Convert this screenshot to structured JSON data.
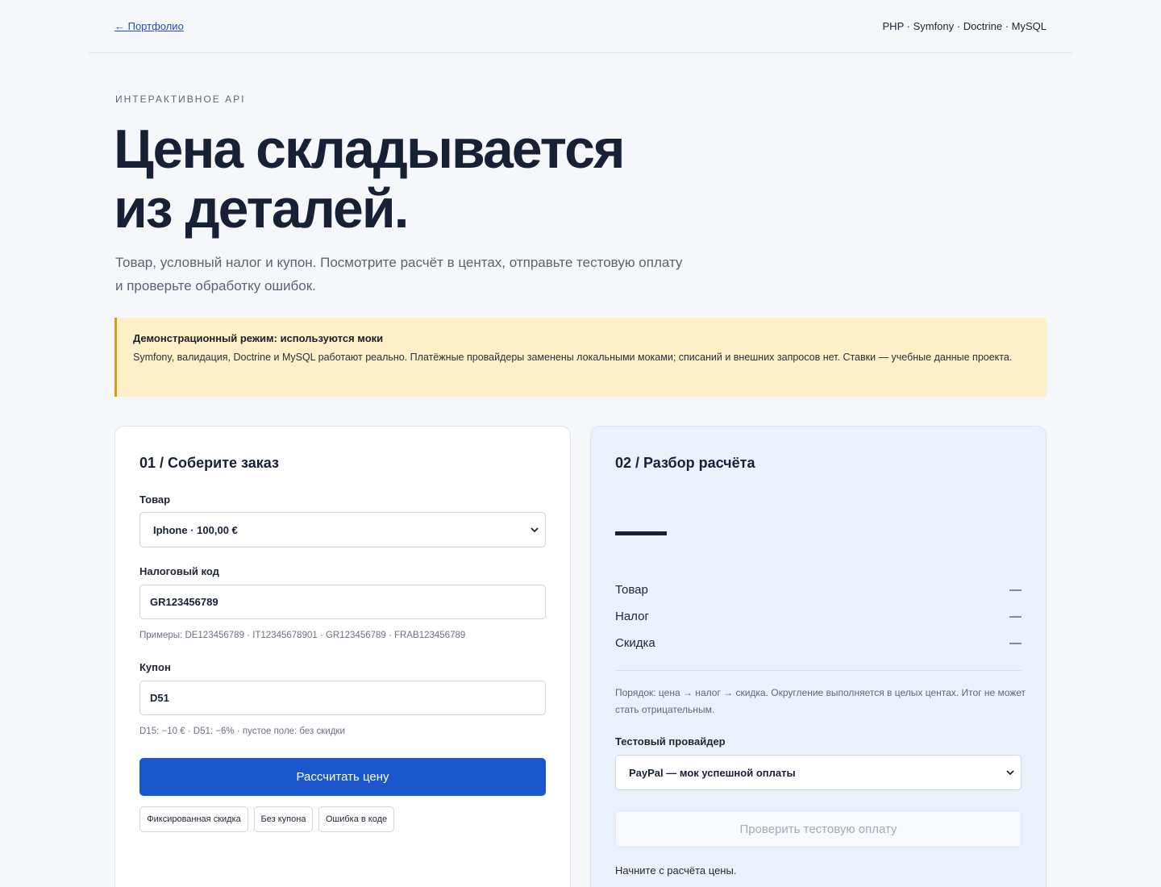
{
  "topbar": {
    "back_link": "← Портфолио",
    "stack": "PHP · Symfony · Doctrine · MySQL"
  },
  "hero": {
    "eyebrow": "ИНТЕРАКТИВНОЕ API",
    "title_line1": "Цена складывается",
    "title_line2": "из деталей.",
    "subtitle_line1": "Товар, условный налог и купон. Посмотрите расчёт в центах, отправьте тестовую оплату",
    "subtitle_line2": "и проверьте обработку ошибок."
  },
  "notice": {
    "title": "Демонстрационный режим: используются моки",
    "text": "Symfony, валидация, Doctrine и MySQL работают реально. Платёжные провайдеры заменены локальными моками; списаний и внешних запросов нет. Ставки — учебные данные проекта."
  },
  "order_card": {
    "title": "01 / Соберите заказ",
    "product_label": "Товар",
    "product_value": "Iphone · 100,00 €",
    "tax_label": "Налоговый код",
    "tax_value": "GR123456789",
    "tax_hint": "Примеры: DE123456789 · IT12345678901 · GR123456789 · FRAB123456789",
    "coupon_label": "Купон",
    "coupon_value": "D51",
    "coupon_hint": "D15: −10 € · D51: −6% · пустое поле: без скидки",
    "calculate_button": "Рассчитать цену",
    "presets": [
      "Фиксированная скидка",
      "Без купона",
      "Ошибка в коде"
    ]
  },
  "breakdown_card": {
    "title": "02 / Разбор расчёта",
    "rows": [
      {
        "label": "Товар",
        "value": "—"
      },
      {
        "label": "Налог",
        "value": "—"
      },
      {
        "label": "Скидка",
        "value": "—"
      }
    ],
    "order_note": "Порядок: цена → налог → скидка. Округление выполняется в целых центах. Итог не может стать отрицательным.",
    "provider_label": "Тестовый провайдер",
    "provider_value": "PayPal — мок успешной оплаты",
    "check_button": "Проверить тестовую оплату",
    "status": "Начните с расчёта цены."
  },
  "colors": {
    "accent": "#1a56cc",
    "notice_bg": "#fdefc8",
    "notice_border": "#d79a1b",
    "heading": "#172034"
  }
}
